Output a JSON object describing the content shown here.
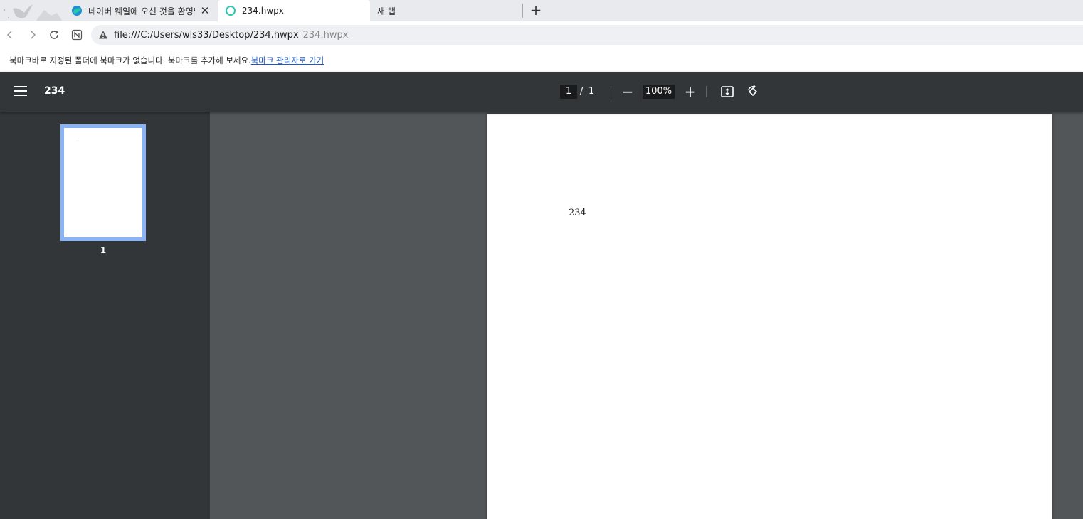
{
  "tabs": [
    {
      "title": "네이버 웨일에 오신 것을 환영합니다",
      "active": false,
      "close": "✕"
    },
    {
      "title": "234.hwpx",
      "active": true
    },
    {
      "title": "새 탭",
      "active": false
    }
  ],
  "newtab_label": "+",
  "address": {
    "url": "file:///C:/Users/wls33/Desktop/234.hwpx",
    "page_title": "234.hwpx"
  },
  "bookmark_bar": {
    "message": "북마크바로 지정된 폴더에 북마크가 없습니다. 북마크를 추가해 보세요.",
    "link": "북마크 관리자로 가기"
  },
  "pdf": {
    "title": "234",
    "current_page": "1",
    "slash": "/",
    "total_pages": "1",
    "zoom_out": "−",
    "zoom": "100%",
    "zoom_in": "+",
    "thumbnail_label": "1",
    "page_text": "234"
  },
  "colors": {
    "toolbar": "#323639",
    "viewer": "#525659",
    "thumb_border": "#8ab4f8",
    "link": "#1a57c6",
    "active_tab_icon": "#2bc8b0"
  },
  "icons": [
    "whale-logo",
    "whale-favicon",
    "loading-ring-icon",
    "back-icon",
    "forward-icon",
    "reload-icon",
    "naver-n-icon",
    "warning-icon",
    "menu-icon",
    "fit-page-icon",
    "rotate-icon"
  ]
}
